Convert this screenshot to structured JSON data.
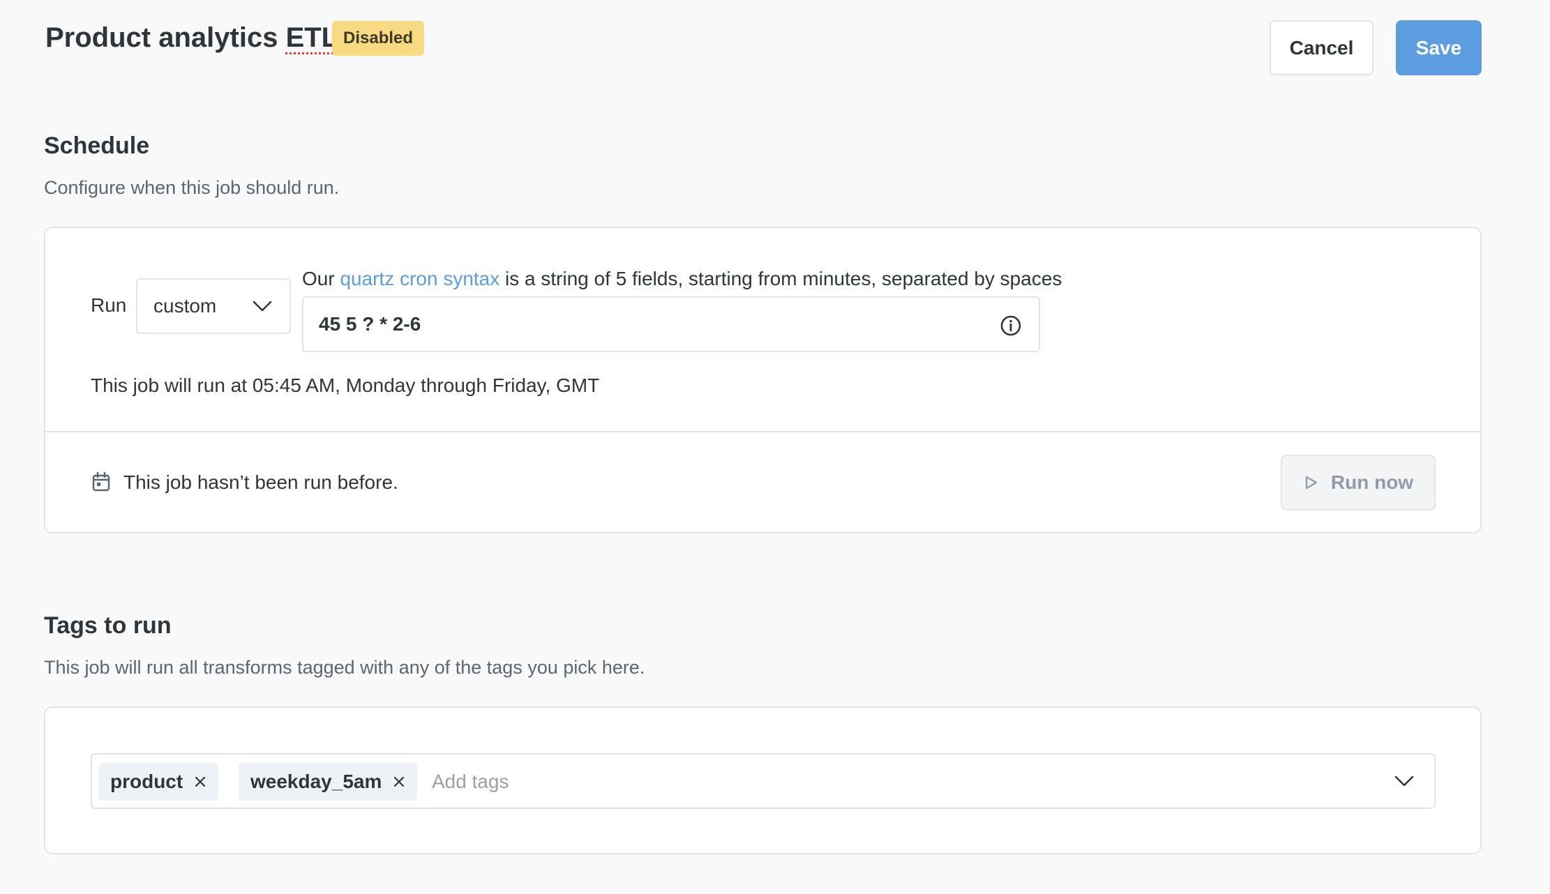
{
  "header": {
    "title_main": "Product analytics ",
    "title_last": "ETL",
    "status_badge": "Disabled",
    "cancel_label": "Cancel",
    "save_label": "Save"
  },
  "schedule": {
    "title": "Schedule",
    "description": "Configure when this job should run.",
    "run_label": "Run",
    "frequency_value": "custom",
    "cron_help_prefix": "Our ",
    "cron_help_link": "quartz cron syntax",
    "cron_help_suffix": " is a string of 5 fields, starting from minutes, separated by spaces",
    "cron_value": "45 5 ? * 2-6",
    "cron_explanation": "This job will run at 05:45 AM, Monday through Friday, GMT",
    "last_run_text": "This job hasn’t been run before.",
    "run_now_label": "Run now"
  },
  "tags": {
    "title": "Tags to run",
    "description": "This job will run all transforms tagged with any of the tags you pick here.",
    "selected": [
      "product",
      "weekday_5am"
    ],
    "placeholder": "Add tags"
  },
  "colors": {
    "background": "#f9f9f9",
    "brand": "#5b9ddf",
    "badge": "#f8da82",
    "border": "#e2e4e6",
    "text": "#2e353b",
    "muted_text": "#5c6670"
  },
  "icons": {
    "frequency_chevron": "chevron-down-icon",
    "cron_info": "info-icon",
    "last_run": "calendar-icon",
    "run_now": "play-icon",
    "chip_remove": "close-icon",
    "tags_chevron": "chevron-down-icon"
  }
}
